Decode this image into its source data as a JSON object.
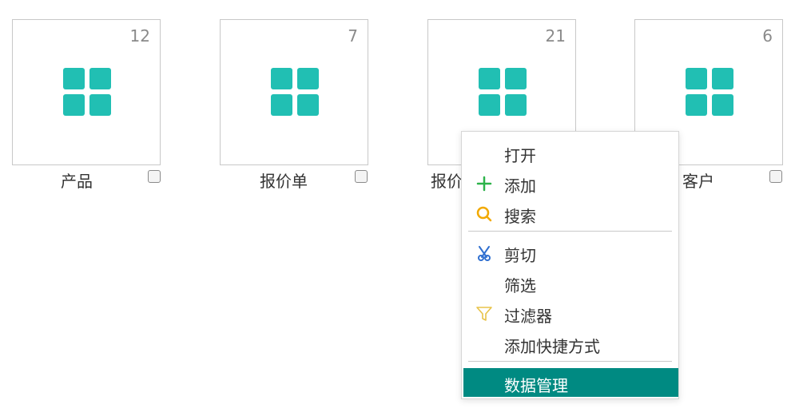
{
  "tiles": [
    {
      "label": "产品",
      "count": "12"
    },
    {
      "label": "报价单",
      "count": "7"
    },
    {
      "label": "报价",
      "count": "21"
    },
    {
      "label": "客户",
      "count": "6"
    }
  ],
  "context_menu": {
    "items": [
      {
        "label": "打开",
        "icon": ""
      },
      {
        "label": "添加",
        "icon": "plus-icon"
      },
      {
        "label": "搜索",
        "icon": "search-icon"
      },
      {
        "label": "剪切",
        "icon": "scissors-icon"
      },
      {
        "label": "筛选",
        "icon": ""
      },
      {
        "label": "过滤器",
        "icon": "filter-icon"
      },
      {
        "label": "添加快捷方式",
        "icon": ""
      },
      {
        "label": "数据管理",
        "icon": ""
      }
    ],
    "highlighted": "数据管理"
  },
  "colors": {
    "tile_icon": "#21bfb3",
    "highlight": "#008a82",
    "plus_icon": "#2db34a",
    "search_icon": "#f2a900",
    "scissors_icon": "#2f6fd0",
    "filter_icon": "#e8c34a"
  }
}
